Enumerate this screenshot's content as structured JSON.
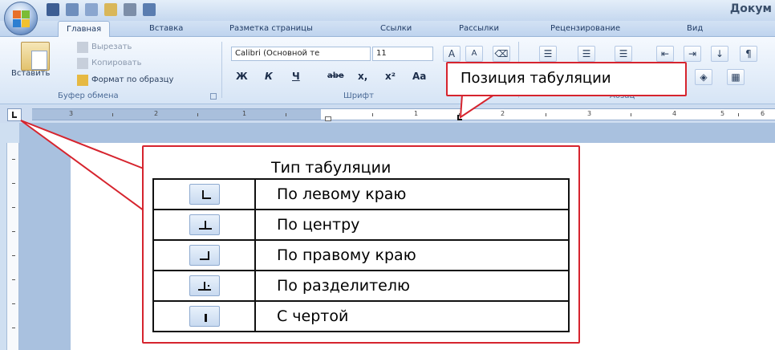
{
  "window": {
    "doc_title": "Докум"
  },
  "tabs": [
    "Главная",
    "Вставка",
    "Разметка страницы",
    "Ссылки",
    "Рассылки",
    "Рецензирование",
    "Вид"
  ],
  "clipboard": {
    "paste_label": "Вставить",
    "cut_label": "Вырезать",
    "copy_label": "Копировать",
    "format_painter_label": "Формат по образцу",
    "caption": "Буфер обмена"
  },
  "font": {
    "name": "Calibri (Основной те",
    "size": "11",
    "caption": "Шрифт",
    "bold": "Ж",
    "italic": "К",
    "underline": "Ч",
    "strike": "abe",
    "subscript": "x,",
    "superscript": "x²",
    "case": "Aa"
  },
  "paragraph": {
    "caption": "Абзац",
    "pilcrow": "¶"
  },
  "ruler": {
    "numbers": [
      "3",
      "2",
      "1",
      "1",
      "2",
      "3",
      "4",
      "5",
      "6"
    ]
  },
  "callout_position": {
    "text": "Позиция табуляции"
  },
  "callout_type": {
    "title": "Тип табуляции",
    "rows": [
      {
        "icon": "left-tab-icon",
        "label": "По левому краю"
      },
      {
        "icon": "center-tab-icon",
        "label": "По центру"
      },
      {
        "icon": "right-tab-icon",
        "label": "По правому краю"
      },
      {
        "icon": "decimal-tab-icon",
        "label": "По разделителю"
      },
      {
        "icon": "bar-tab-icon",
        "label": "С чертой"
      }
    ]
  },
  "colors": {
    "callout_border": "#d6242e",
    "ribbon_bg": "#e3edf9",
    "page_bg": "#a9c1df"
  }
}
